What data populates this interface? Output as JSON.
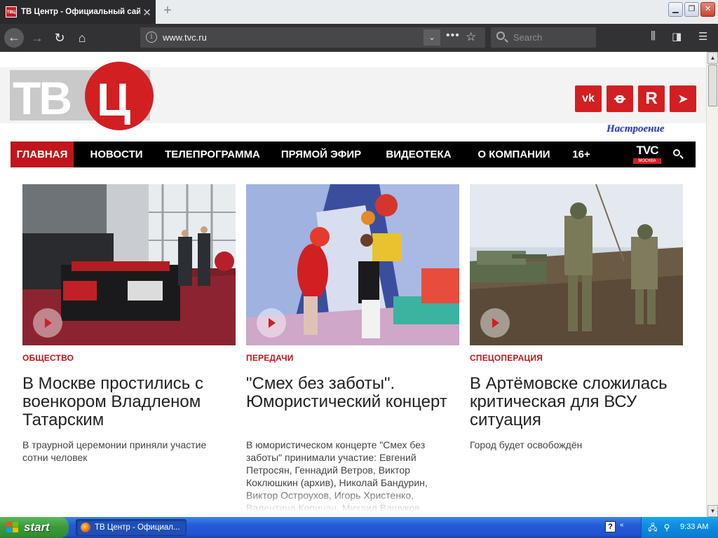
{
  "browser": {
    "tab_title": "ТВ Центр - Официальный сайт т",
    "favicon_text": "ТВЦ",
    "url": "www.tvc.ru",
    "search_placeholder": "Search"
  },
  "site": {
    "logo_tv": "ТВ",
    "logo_c": "Ц",
    "promo_text": "Настроение",
    "social": [
      {
        "name": "vk",
        "label": "vk"
      },
      {
        "name": "odnoklassniki",
        "label": "ok"
      },
      {
        "name": "rutube",
        "label": "R"
      },
      {
        "name": "telegram",
        "label": "telegram"
      }
    ],
    "menu": [
      {
        "label": "ГЛАВНАЯ",
        "active": true
      },
      {
        "label": "НОВОСТИ",
        "active": false
      },
      {
        "label": "ТЕЛЕПРОГРАММА",
        "active": false
      },
      {
        "label": "ПРЯМОЙ ЭФИР",
        "active": false
      },
      {
        "label": "ВИДЕОТЕКА",
        "active": false
      },
      {
        "label": "О КОМПАНИИ",
        "active": false
      },
      {
        "label": "16+",
        "active": false
      }
    ],
    "channel_logo_top": "TVC",
    "channel_logo_bottom": "МОСКВА",
    "cards": [
      {
        "tag": "ОБЩЕСТВО",
        "title": "В Москве простились с военкором Владленом Татарским",
        "desc": "В траурной церемонии приняли участие сотни человек"
      },
      {
        "tag": "ПЕРЕДАЧИ",
        "title": "\"Смех без заботы\". Юмористический концерт",
        "desc": "В юмористическом концерте \"Смех без заботы\" принимали участие: Евгений Петросян, Геннадий Ветров, Виктор Коклюшкин (архив), Николай Бандурин, Виктор Остроухов, Игорь Христенко, Валентина Копинан, Михаил Вашуков"
      },
      {
        "tag": "СПЕЦОПЕРАЦИЯ",
        "title": "В Артёмовске сложилась критическая для ВСУ ситуация",
        "desc": "Город будет освобождён"
      }
    ]
  },
  "taskbar": {
    "start_label": "start",
    "task_label": "ТВ Центр - Официал...",
    "clock": "9:33 AM"
  },
  "colors": {
    "brand_red": "#d21f22",
    "menu_bg": "#000000",
    "browser_dark": "#323234",
    "xp_blue": "#2459d8"
  }
}
